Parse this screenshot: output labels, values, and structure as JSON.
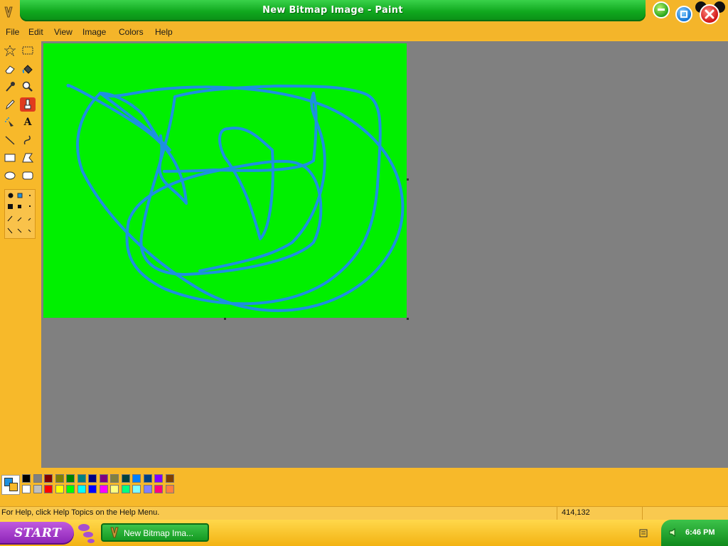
{
  "window": {
    "title": "New Bitmap Image - Paint"
  },
  "menu": [
    "File",
    "Edit",
    "View",
    "Image",
    "Colors",
    "Help"
  ],
  "tools": [
    {
      "name": "free-form-select-tool",
      "icon": "star-select-icon"
    },
    {
      "name": "select-tool",
      "icon": "rect-select-icon"
    },
    {
      "name": "eraser-tool",
      "icon": "eraser-icon"
    },
    {
      "name": "fill-tool",
      "icon": "paint-bucket-icon"
    },
    {
      "name": "pick-color-tool",
      "icon": "eyedropper-icon"
    },
    {
      "name": "magnifier-tool",
      "icon": "magnifier-icon"
    },
    {
      "name": "pencil-tool",
      "icon": "pencil-icon"
    },
    {
      "name": "brush-tool",
      "icon": "brush-icon",
      "selected": true
    },
    {
      "name": "airbrush-tool",
      "icon": "airbrush-icon"
    },
    {
      "name": "text-tool",
      "icon": "text-A-icon",
      "label": "A"
    },
    {
      "name": "line-tool",
      "icon": "line-icon"
    },
    {
      "name": "curve-tool",
      "icon": "curve-icon"
    },
    {
      "name": "rectangle-tool",
      "icon": "rectangle-icon"
    },
    {
      "name": "polygon-tool",
      "icon": "polygon-icon"
    },
    {
      "name": "ellipse-tool",
      "icon": "ellipse-icon"
    },
    {
      "name": "rounded-rectangle-tool",
      "icon": "rounded-rect-icon"
    }
  ],
  "canvas": {
    "background": "#00f000",
    "stroke_color": "#1e90e0"
  },
  "palette": {
    "foreground": "#1e90e0",
    "background": "#f7b92a",
    "row1": [
      "#000000",
      "#808080",
      "#800000",
      "#808000",
      "#008000",
      "#008080",
      "#000080",
      "#800080",
      "#808040",
      "#004040",
      "#0080ff",
      "#004080",
      "#8000ff",
      "#804000"
    ],
    "row2": [
      "#ffffff",
      "#c0c0c0",
      "#ff0000",
      "#ffff00",
      "#00ff00",
      "#00ffff",
      "#0000ff",
      "#ff00ff",
      "#ffff80",
      "#00ff80",
      "#80ffff",
      "#8080ff",
      "#ff0080",
      "#ff8040"
    ]
  },
  "status": {
    "help_text": "For Help, click Help Topics on the Help Menu.",
    "coords": "414,132"
  },
  "taskbar": {
    "start_label": "START",
    "task_label": "New Bitmap Ima...",
    "clock": "6:46 PM"
  }
}
